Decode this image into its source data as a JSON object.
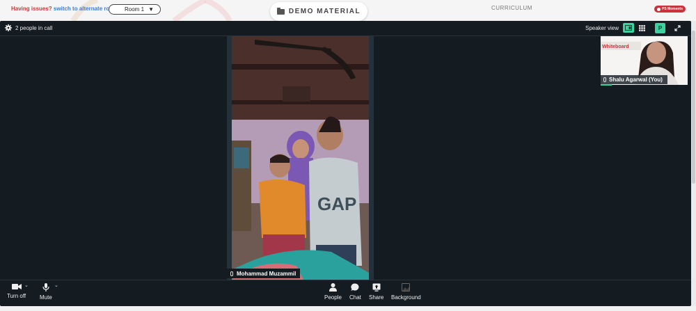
{
  "topbar": {
    "issue_question": "Having issues?",
    "issue_link": "switch to alternate room",
    "room_select": "Room 1",
    "demo_button": "DEMO MATERIAL",
    "curriculum_tab": "CURRICULUM",
    "moments_badge": "PS Moments"
  },
  "call": {
    "people_count": "2 people in call",
    "view_mode": "Speaker view",
    "participant_initial": "P"
  },
  "main_video": {
    "participant_name": "Mohammad Muzammil"
  },
  "self_view": {
    "participant_name": "Shalu Agarwal (You)",
    "overlay_text": "Whiteboard"
  },
  "controls": {
    "camera": "Turn off",
    "mic": "Mute",
    "people": "People",
    "chat": "Chat",
    "share": "Share",
    "background": "Background"
  },
  "colors": {
    "accent": "#3ad29f",
    "badge": "#c8323c",
    "call_bg": "#141c22",
    "link": "#3b7dd8",
    "warning": "#c43a3a"
  }
}
